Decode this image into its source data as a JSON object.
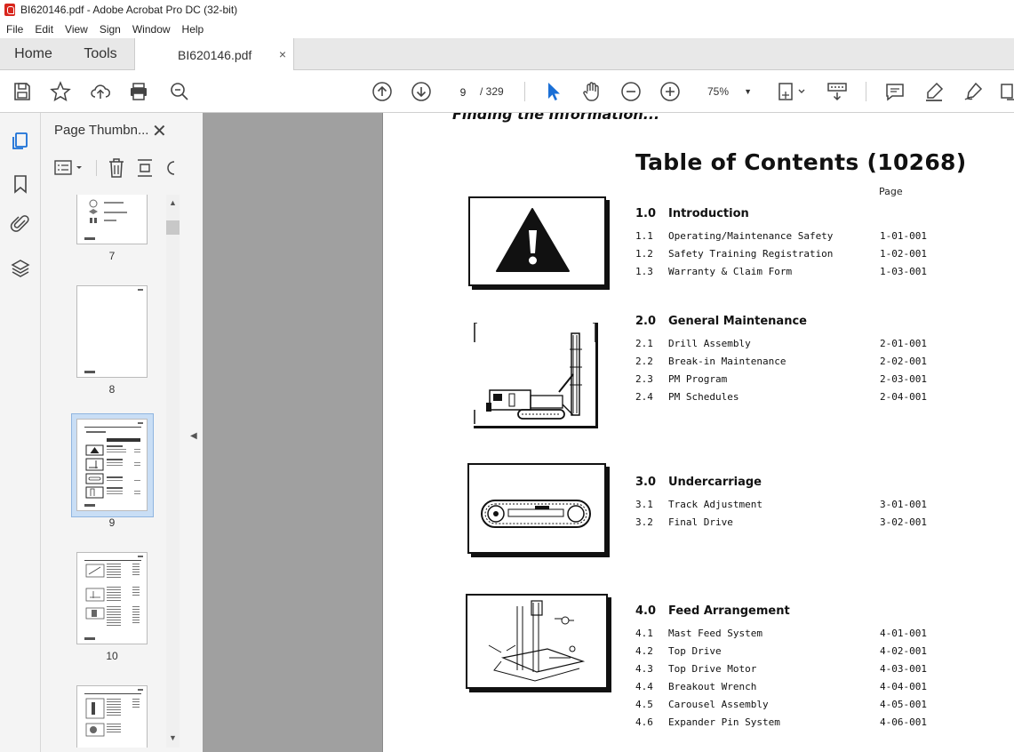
{
  "window": {
    "title": "BI620146.pdf - Adobe Acrobat Pro DC (32-bit)"
  },
  "menu": [
    "File",
    "Edit",
    "View",
    "Sign",
    "Window",
    "Help"
  ],
  "tabs": {
    "home": "Home",
    "tools": "Tools",
    "document": "BI620146.pdf",
    "close": "×"
  },
  "toolbar": {
    "current_page": "9",
    "total_pages": "/ 329",
    "zoom": "75%"
  },
  "panel": {
    "title": "Page Thumbn...",
    "close": "✕"
  },
  "thumbnails": [
    {
      "label": "7"
    },
    {
      "label": "8"
    },
    {
      "label": "9",
      "selected": true
    },
    {
      "label": "10"
    }
  ],
  "document": {
    "heading": "Finding the Information...",
    "toc_title": "Table of Contents (10268)",
    "page_column_label": "Page",
    "sections": [
      {
        "num": "1.0",
        "title": "Introduction",
        "items": [
          {
            "num": "1.1",
            "title": "Operating/Maintenance Safety",
            "page": "1-01-001"
          },
          {
            "num": "1.2",
            "title": "Safety Training Registration",
            "page": "1-02-001"
          },
          {
            "num": "1.3",
            "title": "Warranty & Claim Form",
            "page": "1-03-001"
          }
        ]
      },
      {
        "num": "2.0",
        "title": "General Maintenance",
        "items": [
          {
            "num": "2.1",
            "title": "Drill Assembly",
            "page": "2-01-001"
          },
          {
            "num": "2.2",
            "title": "Break-in Maintenance",
            "page": "2-02-001"
          },
          {
            "num": "2.3",
            "title": "PM Program",
            "page": "2-03-001"
          },
          {
            "num": "2.4",
            "title": "PM Schedules",
            "page": "2-04-001"
          }
        ]
      },
      {
        "num": "3.0",
        "title": "Undercarriage",
        "items": [
          {
            "num": "3.1",
            "title": "Track Adjustment",
            "page": "3-01-001"
          },
          {
            "num": "3.2",
            "title": "Final Drive",
            "page": "3-02-001"
          }
        ]
      },
      {
        "num": "4.0",
        "title": "Feed Arrangement",
        "items": [
          {
            "num": "4.1",
            "title": "Mast Feed System",
            "page": "4-01-001"
          },
          {
            "num": "4.2",
            "title": "Top Drive",
            "page": "4-02-001"
          },
          {
            "num": "4.3",
            "title": "Top Drive Motor",
            "page": "4-03-001"
          },
          {
            "num": "4.4",
            "title": "Breakout Wrench",
            "page": "4-04-001"
          },
          {
            "num": "4.5",
            "title": "Carousel Assembly",
            "page": "4-05-001"
          },
          {
            "num": "4.6",
            "title": "Expander Pin System",
            "page": "4-06-001"
          }
        ]
      }
    ]
  }
}
